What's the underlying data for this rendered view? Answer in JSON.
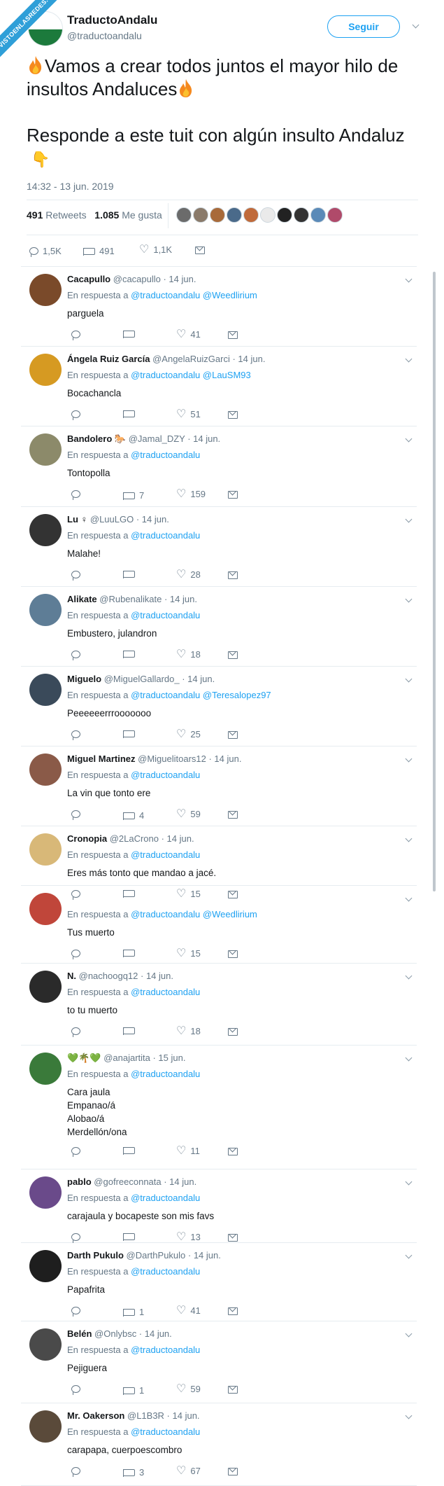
{
  "watermark": "VISTOENLASREDES.COM",
  "tweet": {
    "author_name": "TraductoAndalu",
    "author_handle": "@traductoandalu",
    "follow_label": "Seguir",
    "text_line1": "Vamos a crear todos juntos el mayor hilo de insultos Andaluces",
    "text_line2": "Responde a este tuit con algún insulto Andaluz",
    "timestamp": "14:32 - 13 jun. 2019",
    "retweets_count": "491",
    "retweets_label": "Retweets",
    "likes_count": "1.085",
    "likes_label": "Me gusta",
    "reply_count": "1,5K",
    "rt_count": "491",
    "like_count": "1,1K"
  },
  "replies": [
    {
      "name": "Cacapullo",
      "handle": "@cacapullo · 14 jun.",
      "reply_prefix": "En respuesta a",
      "mentions": "@traductoandalu @Weedlirium",
      "text": "parguela",
      "retweets": "",
      "likes": "41",
      "avatar_color": "#7a4a2a"
    },
    {
      "name": "Ángela Ruiz García",
      "handle": "@AngelaRuizGarci · 14 jun.",
      "reply_prefix": "En respuesta a",
      "mentions": "@traductoandalu @LauSM93",
      "text": "Bocachancla",
      "retweets": "",
      "likes": "51",
      "avatar_color": "#d69a22"
    },
    {
      "name": "Bandolero 🐎",
      "handle": "@Jamal_DZY · 14 jun.",
      "reply_prefix": "En respuesta a",
      "mentions": "@traductoandalu",
      "text": "Tontopolla",
      "retweets": "7",
      "likes": "159",
      "avatar_color": "#8c8a6a"
    },
    {
      "name": "Lu ♀",
      "handle": "@LuuLGO · 14 jun.",
      "reply_prefix": "En respuesta a",
      "mentions": "@traductoandalu",
      "text": "Malahe!",
      "retweets": "",
      "likes": "28",
      "avatar_color": "#333333"
    },
    {
      "name": "Alikate",
      "handle": "@Rubenalikate · 14 jun.",
      "reply_prefix": "En respuesta a",
      "mentions": "@traductoandalu",
      "text": "Embustero, julandron",
      "retweets": "",
      "likes": "18",
      "avatar_color": "#5e7d96"
    },
    {
      "name": "Miguelo",
      "handle": "@MiguelGallardo_ · 14 jun.",
      "reply_prefix": "En respuesta a",
      "mentions": "@traductoandalu @Teresalopez97",
      "text": "Peeeeeerrrooooooo",
      "retweets": "",
      "likes": "25",
      "avatar_color": "#3a4a5a"
    },
    {
      "name": "Miguel Martinez",
      "handle": "@Miguelitoars12 · 14 jun.",
      "reply_prefix": "En respuesta a",
      "mentions": "@traductoandalu",
      "text": "La vin que tonto ere",
      "retweets": "4",
      "likes": "59",
      "avatar_color": "#8a5a48"
    },
    {
      "name": "Cronopia",
      "handle": "@2LaCrono · 14 jun.",
      "reply_prefix": "En respuesta a",
      "mentions": "@traductoandalu",
      "text": "Eres más tonto que mandao a jacé.",
      "retweets": "",
      "likes": "15",
      "avatar_color": "#d8b878"
    },
    {
      "name": "",
      "handle": "",
      "reply_prefix": "En respuesta a",
      "mentions": "@traductoandalu @Weedlirium",
      "text": "Tus muerto",
      "retweets": "",
      "likes": "15",
      "avatar_color": "#c0463a"
    },
    {
      "name": "N.",
      "handle": "@nachoogq12 · 14 jun.",
      "reply_prefix": "En respuesta a",
      "mentions": "@traductoandalu",
      "text": "to tu muerto",
      "retweets": "",
      "likes": "18",
      "avatar_color": "#2a2a2a"
    },
    {
      "name": "💚🌴💚",
      "handle": "@anajartita · 15 jun.",
      "reply_prefix": "En respuesta a",
      "mentions": "@traductoandalu",
      "text": "Cara jaula\nEmpanao/á\nAlobao/á\nMerdellón/ona",
      "retweets": "",
      "likes": "11",
      "avatar_color": "#3a7a3a"
    },
    {
      "name": "pablo",
      "handle": "@gofreeconnata · 14 jun.",
      "reply_prefix": "En respuesta a",
      "mentions": "@traductoandalu",
      "text": "carajaula y bocapeste son mis favs",
      "retweets": "",
      "likes": "13",
      "avatar_color": "#6a4a8a"
    },
    {
      "name": "Darth Pukulo",
      "handle": "@DarthPukulo · 14 jun.",
      "reply_prefix": "En respuesta a",
      "mentions": "@traductoandalu",
      "text": "Papafrita",
      "retweets": "1",
      "likes": "41",
      "avatar_color": "#1e1e1e"
    },
    {
      "name": "Belén",
      "handle": "@Onlybsc · 14 jun.",
      "reply_prefix": "En respuesta a",
      "mentions": "@traductoandalu",
      "text": "Pejiguera",
      "retweets": "1",
      "likes": "59",
      "avatar_color": "#4a4a4a"
    },
    {
      "name": "Mr. Oakerson",
      "handle": "@L1B3R · 14 jun.",
      "reply_prefix": "En respuesta a",
      "mentions": "@traductoandalu",
      "text": "carapapa, cuerpoescombro",
      "retweets": "3",
      "likes": "67",
      "avatar_color": "#5a4a3a"
    }
  ]
}
